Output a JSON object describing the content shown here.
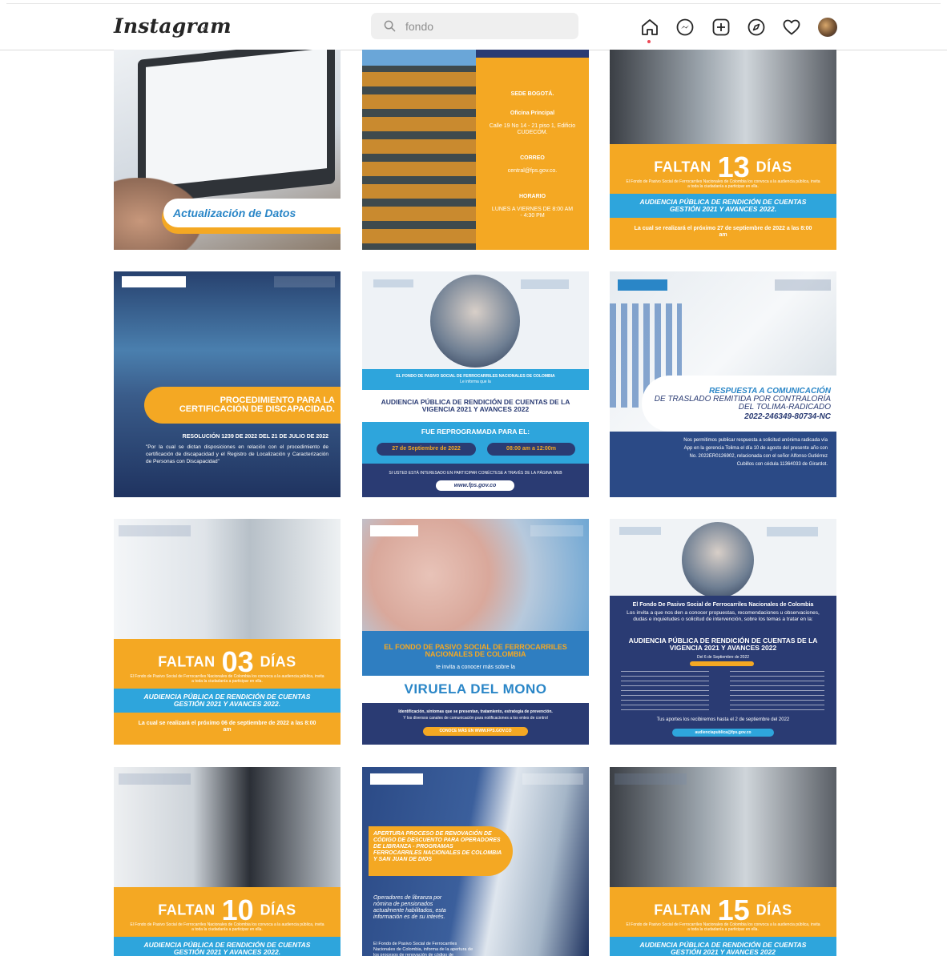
{
  "app": {
    "logo": "Instagram",
    "logo_caret": "⌄"
  },
  "search": {
    "value": "fondo"
  },
  "nav": {
    "icons": [
      "home-icon",
      "messenger-icon",
      "new-post-icon",
      "explore-icon",
      "activity-heart-icon",
      "profile-avatar"
    ]
  },
  "posts": {
    "p1": {
      "title": "Actualización de Datos"
    },
    "p2": {
      "sede": "SEDE BOGOTÁ.",
      "oficina": "Oficina Principal",
      "direccion": "Calle 19 No 14 - 21 piso 1, Edificio CUDECOM.",
      "correo_label": "CORREO",
      "correo": "central@fps.gov.co.",
      "horario_label": "HORARIO",
      "horario": "LUNES A VIERNES DE 8:00 AM - 4:30 PM"
    },
    "p3": {
      "faltan": "FALTAN",
      "numero": "13",
      "dias": "DÍAS",
      "texto": "El Fondo de Pasivo Social de Ferrocarriles Nacionales de Colombia los convoca a la audiencia pública, invita a toda la ciudadanía a participar en ella.",
      "audiencia": "AUDIENCIA PÚBLICA DE RENDICIÓN DE CUENTAS GESTIÓN 2021 Y AVANCES 2022.",
      "fecha": "La cual se realizará el próximo 27 de septiembre de 2022 a las 8:00 am"
    },
    "p4": {
      "titulo": "PROCEDIMIENTO PARA LA CERTIFICACIÓN DE DISCAPACIDAD.",
      "resolucion": "RESOLUCIÓN 1239 DE 2022 DEL 21 DE JULIO DE 2022",
      "texto": "\"Por la cual se dictan disposiciones en relación con el procedimiento de certificación de discapacidad y el Registro de Localización y Caracterización de Personas con Discapacidad\""
    },
    "p5": {
      "fondo": "EL FONDO DE PASIVO SOCIAL DE FERROCARRILES NACIONALES DE COLOMBIA",
      "informa": "Le informa que la",
      "audiencia": "AUDIENCIA PÚBLICA DE RENDICIÓN DE CUENTAS DE LA VIGENCIA 2021 Y AVANCES 2022",
      "reprogramada": "FUE REPROGRAMADA PARA EL:",
      "fecha": "27 de Septiembre de 2022",
      "hora": "08:00 am a 12:00m",
      "interesado": "SI USTED ESTÁ INTERESADO EN PARTICIPAR CONÉCTESE A TRAVÉS DE LA PÁGINA WEB",
      "web": "www.fps.gov.co"
    },
    "p6": {
      "titulo1": "RESPUESTA A COMUNICACIÓN",
      "titulo2": "DE TRASLADO REMITIDA POR CONTRALORÍA DEL TOLIMA-RADICADO",
      "radicado": "2022-246349-80734-NC",
      "texto": "Nos permitimos publicar respuesta a solicitud anónima radicada vía App en la gerencia Tolima el día 10 de agosto del presente año con No. 2022ER0126902, relacionada con el señor Alfonso Gutiérrez Cubillos con cédula 11364033 de Girardot."
    },
    "p7": {
      "faltan": "FALTAN",
      "numero": "03",
      "dias": "DÍAS",
      "texto": "El Fondo de Pasivo Social de Ferrocarriles Nacionales de Colombia los convoca a la audiencia pública, invita a toda la ciudadanía a participar en ella.",
      "audiencia": "AUDIENCIA PÚBLICA DE RENDICIÓN DE CUENTAS GESTIÓN 2021 Y AVANCES 2022.",
      "fecha": "La cual se realizará el próximo 06 de septiembre de 2022 a las 8:00 am"
    },
    "p8": {
      "titulo": "EL FONDO DE PASIVO SOCIAL DE FERROCARRILES NACIONALES DE COLOMBIA",
      "invita": "te invita a conocer más sobre la",
      "viruela": "VIRUELA DEL MONO",
      "identificacion": "Identificación, síntomas que se presentan, tratamiento, estrategia de prevención.",
      "canales": "Y los diversos canales de comunicación para notificaciones a los entes de control",
      "boton": "CONOCE MÁS EN WWW.FPS.GOV.CO"
    },
    "p9": {
      "fondo": "El Fondo De Pasivo Social de Ferrocarriles Nacionales de Colombia",
      "invita": "Los invita a que nos den a conocer propuestas, recomendaciones u observaciones, dudas e inquietudes o solicitud de intervención, sobre los temas a tratar en la:",
      "audiencia": "AUDIENCIA PÚBLICA DE RENDICIÓN DE CUENTAS DE LA VIGENCIA 2021 Y AVANCES 2022",
      "fecha": "Del 6 de Septiembre de 2022",
      "aportes": "Tus aportes los recibiremos hasta el 2 de septiembre del 2022",
      "correo": "audienciapublica@fps.gov.co"
    },
    "p10": {
      "faltan": "FALTAN",
      "numero": "10",
      "dias": "DÍAS",
      "texto": "El Fondo de Pasivo Social de Ferrocarriles Nacionales de Colombia los convoca a la audiencia pública, invita a toda la ciudadanía a participar en ella.",
      "audiencia": "AUDIENCIA PÚBLICA DE RENDICIÓN DE CUENTAS GESTIÓN 2021 Y AVANCES 2022."
    },
    "p11": {
      "titulo": "APERTURA PROCESO DE RENOVACIÓN DE CÓDIGO DE DESCUENTO PARA OPERADORES DE LIBRANZA - PROGRAMAS FERROCARRILES NACIONALES DE COLOMBIA Y SAN JUAN DE DIOS",
      "operadores": "Operadores de libranza por nómina de pensionados actualmente habilitados, esta información es de su interés.",
      "texto": "El Fondo de Pasivo Social de Ferrocarriles Nacionales de Colombia, informa de la apertura de los procesos de renovación de código de"
    },
    "p12": {
      "faltan": "FALTAN",
      "numero": "15",
      "dias": "DÍAS",
      "texto": "El Fondo de Pasivo Social de Ferrocarriles Nacionales de Colombia los convoca a la audiencia pública, invita a toda la ciudadanía a participar en ella.",
      "audiencia": "AUDIENCIA PÚBLICA DE RENDICIÓN DE CUENTAS GESTIÓN 2021 Y AVANCES 2022"
    }
  },
  "colors": {
    "orange": "#f4a823",
    "blue": "#2ea5dc",
    "navy": "#2a3b73"
  }
}
